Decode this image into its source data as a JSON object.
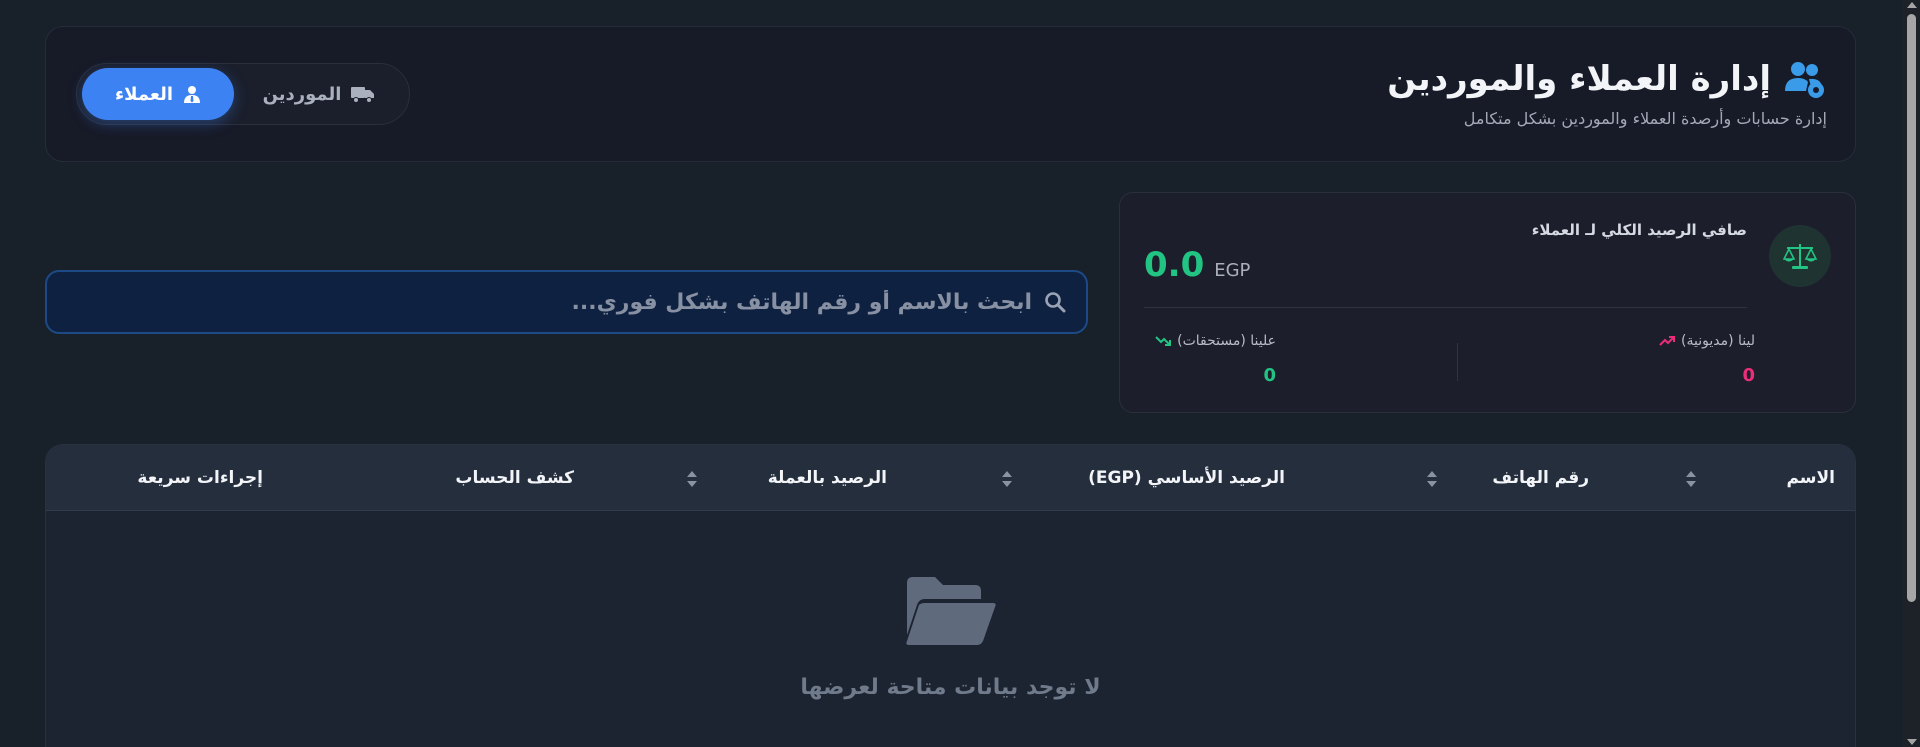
{
  "header": {
    "title": "إدارة العملاء والموردين",
    "subtitle": "إدارة حسابات وأرصدة العملاء والموردين بشكل متكامل",
    "title_icon": "users-gear-icon"
  },
  "toggle": {
    "active_label": "العملاء",
    "active_icon": "user-tie-icon",
    "inactive_label": "الموردين",
    "inactive_icon": "truck-icon"
  },
  "balance": {
    "label": "صافي الرصيد الكلي لـ العملاء",
    "amount": "0.0",
    "currency": "EGP",
    "icon": "scale-balance-icon",
    "debt": {
      "label": "لينا (مديونية)",
      "value": "0",
      "icon": "trend-up-icon"
    },
    "credit": {
      "label": "علينا (مستحقات)",
      "value": "0",
      "icon": "trend-down-icon"
    }
  },
  "search": {
    "placeholder": "ابحث بالاسم أو رقم الهاتف بشكل فوري...",
    "value": ""
  },
  "table": {
    "columns": [
      "الاسم",
      "رقم الهاتف",
      "الرصيد الأساسي (EGP)",
      "الرصيد بالعملة",
      "كشف الحساب",
      "إجراءات سريعة"
    ],
    "rows": [],
    "empty_message": "لا توجد بيانات متاحة لعرضها",
    "empty_icon": "folder-open-icon"
  },
  "colors": {
    "accent": "#3d82f2",
    "positive": "#22c483",
    "negative": "#ec2d7a",
    "background": "#18202a"
  }
}
